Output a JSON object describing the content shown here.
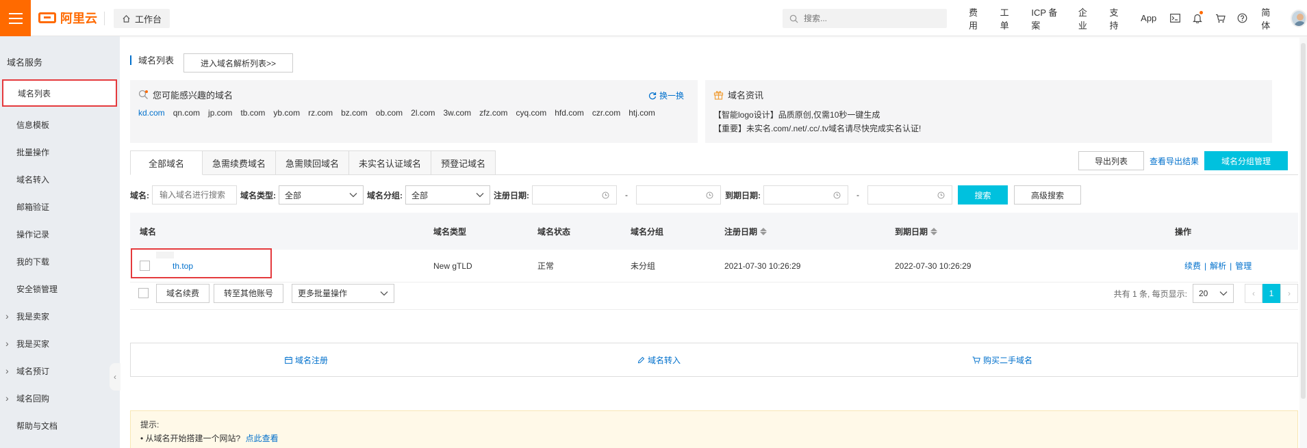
{
  "topbar": {
    "logo_text": "阿里云",
    "workbench_label": "工作台",
    "search_placeholder": "搜索...",
    "nav": [
      "费用",
      "工单",
      "ICP 备案",
      "企业",
      "支持",
      "App"
    ],
    "lang_label": "简体",
    "accent_color": "#ff6a00"
  },
  "sidebar": {
    "title": "域名服务",
    "items": [
      {
        "label": "域名列表",
        "active": true
      },
      {
        "label": "信息模板"
      },
      {
        "label": "批量操作"
      },
      {
        "label": "域名转入"
      },
      {
        "label": "邮箱验证"
      },
      {
        "label": "操作记录"
      },
      {
        "label": "我的下载"
      },
      {
        "label": "安全锁管理"
      },
      {
        "label": "我是卖家",
        "caret": true
      },
      {
        "label": "我是买家",
        "caret": true
      },
      {
        "label": "域名预订",
        "caret": true
      },
      {
        "label": "域名回购",
        "caret": true
      },
      {
        "label": "帮助与文档"
      }
    ]
  },
  "main": {
    "page_title": "域名列表",
    "resolve_button": "进入域名解析列表>>",
    "interest_panel": {
      "title": "您可能感兴趣的域名",
      "refresh_label": "换一换",
      "domains": [
        "kd.com",
        "qn.com",
        "jp.com",
        "tb.com",
        "yb.com",
        "rz.com",
        "bz.com",
        "ob.com",
        "2l.com",
        "3w.com",
        "zfz.com",
        "cyq.com",
        "hfd.com",
        "czr.com",
        "htj.com"
      ]
    },
    "news_panel": {
      "title": "域名资讯",
      "lines": [
        "【智能logo设计】品质原创,仅需10秒一键生成",
        "【重要】未实名.com/.net/.cc/.tv域名请尽快完成实名认证!"
      ]
    },
    "tabs": [
      "全部域名",
      "急需续费域名",
      "急需赎回域名",
      "未实名认证域名",
      "预登记域名"
    ],
    "export_button": "导出列表",
    "export_result_link": "查看导出结果",
    "group_manage_button": "域名分组管理",
    "filters": {
      "domain_label": "域名:",
      "domain_placeholder": "输入域名进行搜索",
      "type_label": "域名类型:",
      "type_value": "全部",
      "group_label": "域名分组:",
      "group_value": "全部",
      "reg_date_label": "注册日期:",
      "exp_date_label": "到期日期:",
      "dash": "-",
      "search_button": "搜索",
      "advanced_button": "高级搜索"
    },
    "table": {
      "headers": [
        "域名",
        "域名类型",
        "域名状态",
        "域名分组",
        "注册日期",
        "到期日期",
        "操作"
      ],
      "rows": [
        {
          "domain": "th.top",
          "type": "New gTLD",
          "status": "正常",
          "group": "未分组",
          "reg_date": "2021-07-30 10:26:29",
          "exp_date": "2022-07-30 10:26:29",
          "actions": [
            "续费",
            "解析",
            "管理"
          ]
        }
      ],
      "action_sep": "|"
    },
    "bulk": {
      "renew_button": "域名续费",
      "transfer_button": "转至其他账号",
      "more_select": "更多批量操作"
    },
    "pager": {
      "summary": "共有 1 条, 每页显示:",
      "page_size": "20",
      "current_page": "1",
      "prev": "‹",
      "next": "›"
    },
    "quick_links": [
      "域名注册",
      "域名转入",
      "购买二手域名"
    ],
    "tip": {
      "title": "提示:",
      "text": "• 从域名开始搭建一个网站?",
      "link": "点此查看"
    },
    "primary_color": "#00c1de",
    "link_color": "#0070cc"
  }
}
